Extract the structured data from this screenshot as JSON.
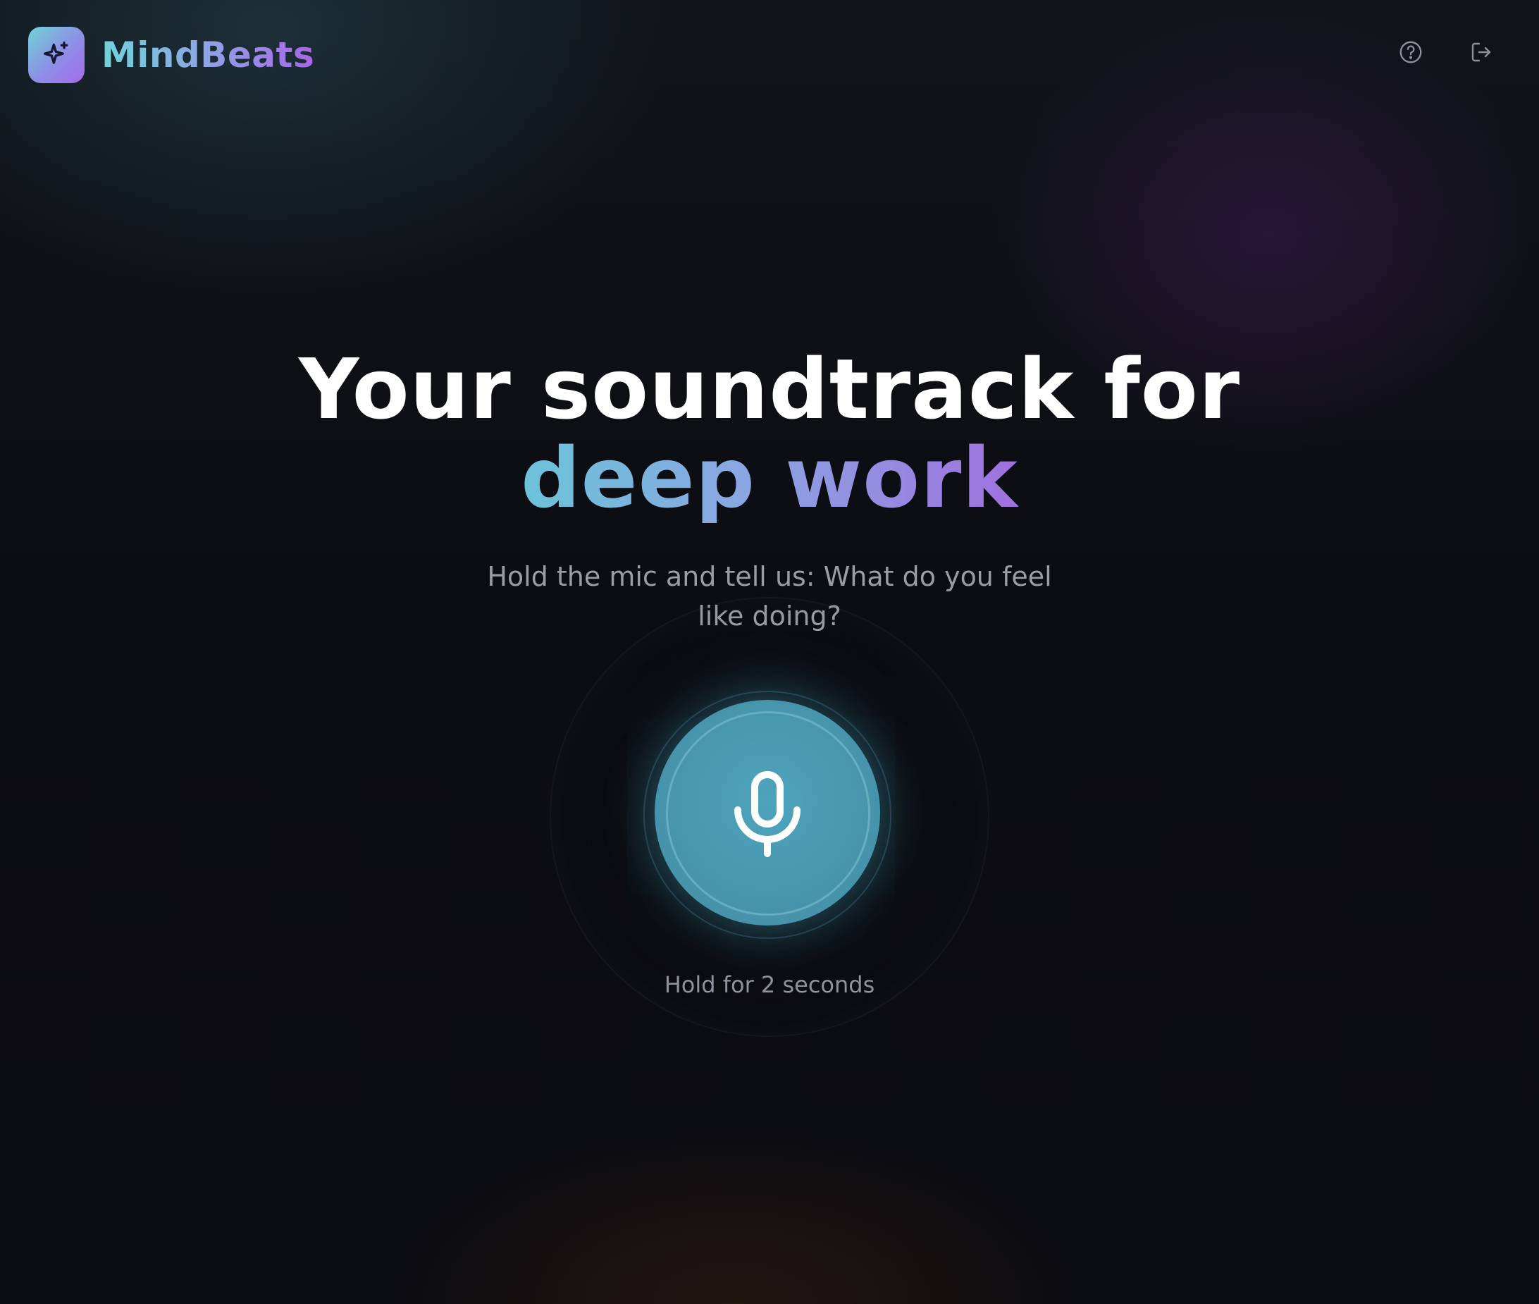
{
  "app": {
    "name": "MindBeats",
    "logo_icon": "sparkles-icon"
  },
  "header": {
    "actions": [
      {
        "name": "help",
        "icon": "help-circle-icon"
      },
      {
        "name": "logout",
        "icon": "logout-icon"
      }
    ]
  },
  "hero": {
    "headline_line1": "Your soundtrack for",
    "headline_line2": "deep work",
    "subtitle": "Hold the mic and tell us: What do you feel like doing?"
  },
  "mic": {
    "icon": "microphone-icon",
    "hint": "Hold for 2 seconds"
  },
  "colors": {
    "background": "#0c0d12",
    "accent_teal": "#6fd3d8",
    "accent_purple": "#a866e6",
    "mic_fill": "#4795ac"
  }
}
